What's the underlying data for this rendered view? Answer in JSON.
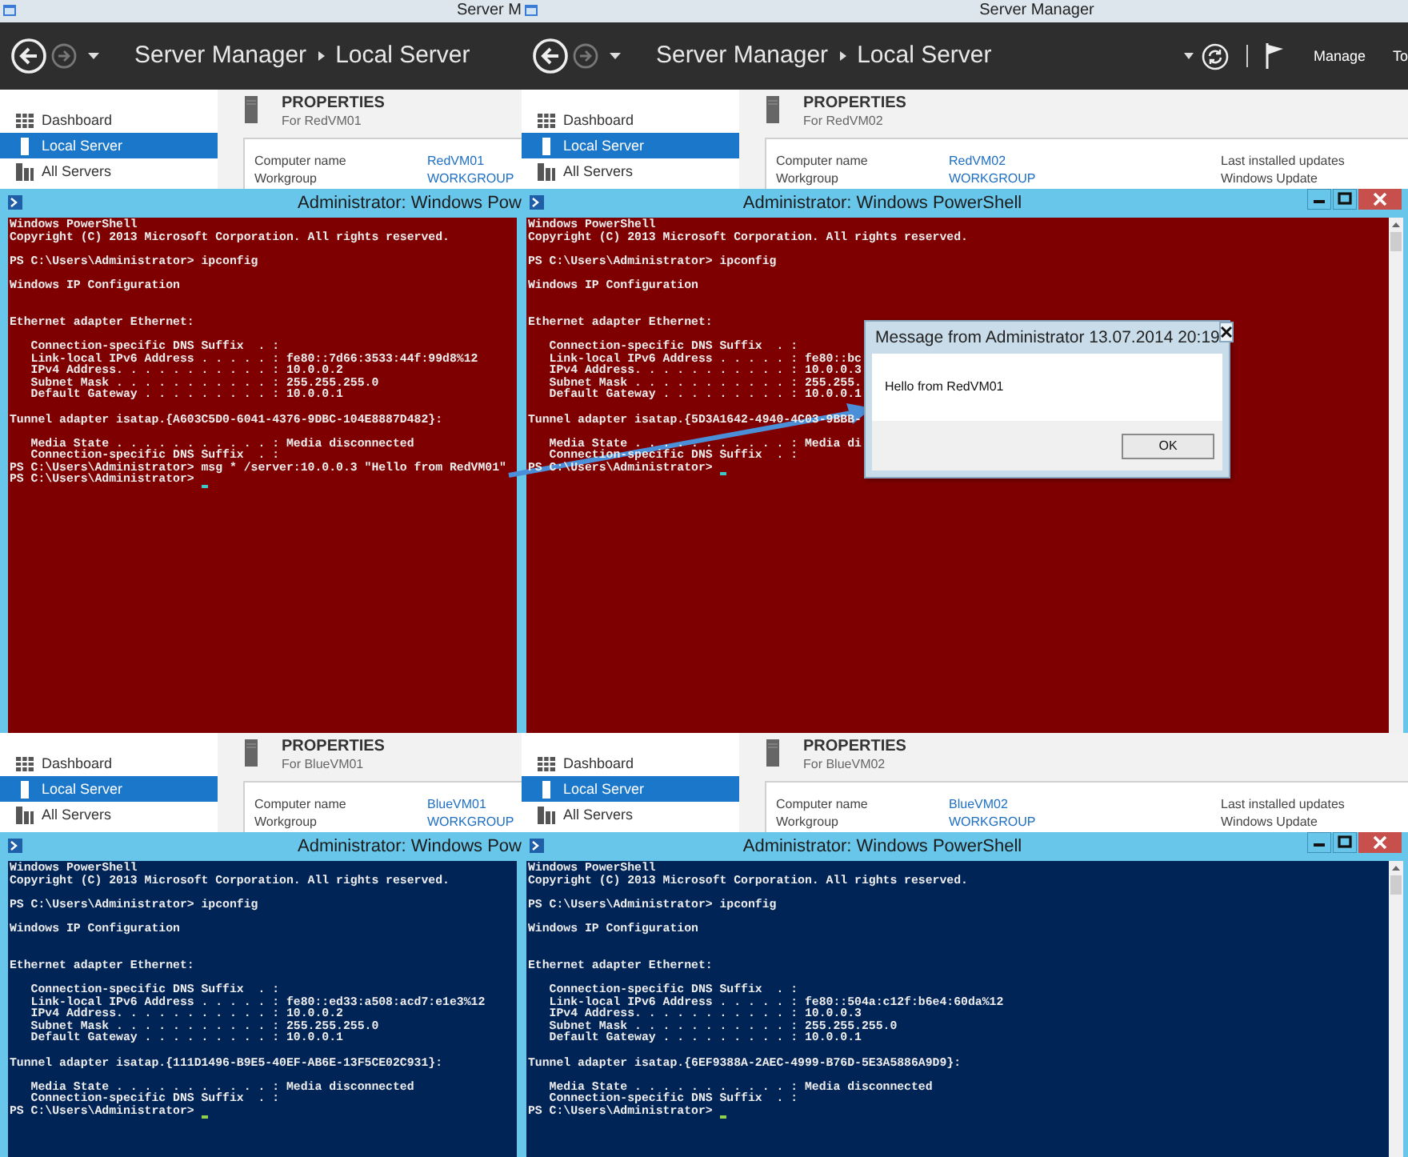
{
  "screens": [
    {
      "title_bar": "Server M",
      "header": {
        "breadcrumb": [
          "Server Manager",
          "Local Server"
        ]
      },
      "sidebar": [
        {
          "label": "Dashboard",
          "selected": false
        },
        {
          "label": "Local Server",
          "selected": true
        },
        {
          "label": "All Servers",
          "selected": false
        }
      ],
      "properties": {
        "heading": "PROPERTIES",
        "subtitle": "For RedVM01",
        "fields": [
          {
            "label": "Computer name",
            "value": "RedVM01"
          },
          {
            "label": "Workgroup",
            "value": "WORKGROUP"
          }
        ]
      },
      "powershell": {
        "title": "Administrator: Windows Pow",
        "color": "#7f0000",
        "window_buttons": false,
        "cursor": true,
        "blocks": [
          {
            "lines": [
              "Windows PowerShell",
              "Copyright (C) 2013 Microsoft Corporation. All rights reserved."
            ]
          },
          {
            "lines": [
              "PS C:\\Users\\Administrator> ipconfig"
            ]
          },
          {
            "lines": [
              "Windows IP Configuration"
            ],
            "extra_blank": true
          },
          {
            "lines": [
              "Ethernet adapter Ethernet:"
            ]
          },
          {
            "lines": [
              "   Connection-specific DNS Suffix  . :",
              "   Link-local IPv6 Address . . . . . : fe80::7d66:3533:44f:99d8%12",
              "   IPv4 Address. . . . . . . . . . . : 10.0.0.2",
              "   Subnet Mask . . . . . . . . . . . : 255.255.255.0",
              "   Default Gateway . . . . . . . . . : 10.0.0.1"
            ]
          },
          {
            "lines": [
              "Tunnel adapter isatap.{A603C5D0-6041-4376-9DBC-104E8887D482}:"
            ]
          },
          {
            "lines": [
              "   Media State . . . . . . . . . . . : Media disconnected",
              "   Connection-specific DNS Suffix  . :",
              "PS C:\\Users\\Administrator> msg * /server:10.0.0.3 \"Hello from RedVM01\"",
              "PS C:\\Users\\Administrator> "
            ]
          }
        ]
      }
    },
    {
      "title_bar": "Server Manager",
      "header": {
        "breadcrumb": [
          "Server Manager",
          "Local Server"
        ],
        "menu": [
          "Manage",
          "To"
        ]
      },
      "sidebar": [
        {
          "label": "Dashboard",
          "selected": false
        },
        {
          "label": "Local Server",
          "selected": true
        },
        {
          "label": "All Servers",
          "selected": false
        }
      ],
      "properties": {
        "heading": "PROPERTIES",
        "subtitle": "For RedVM02",
        "fields": [
          {
            "label": "Computer name",
            "value": "RedVM02"
          },
          {
            "label": "Workgroup",
            "value": "WORKGROUP"
          }
        ],
        "side_labels": [
          "Last installed updates",
          "Windows Update"
        ]
      },
      "powershell": {
        "title": "Administrator: Windows PowerShell",
        "color": "#7f0000",
        "window_buttons": true,
        "cursor": true,
        "blocks": [
          {
            "lines": [
              "Windows PowerShell",
              "Copyright (C) 2013 Microsoft Corporation. All rights reserved."
            ]
          },
          {
            "lines": [
              "PS C:\\Users\\Administrator> ipconfig"
            ]
          },
          {
            "lines": [
              "Windows IP Configuration"
            ],
            "extra_blank": true
          },
          {
            "lines": [
              "Ethernet adapter Ethernet:"
            ]
          },
          {
            "lines": [
              "   Connection-specific DNS Suffix  . :",
              "   Link-local IPv6 Address . . . . . : fe80::bc",
              "   IPv4 Address. . . . . . . . . . . : 10.0.0.3",
              "   Subnet Mask . . . . . . . . . . . : 255.255.",
              "   Default Gateway . . . . . . . . . : 10.0.0.1"
            ]
          },
          {
            "lines": [
              "Tunnel adapter isatap.{5D3A1642-4940-4C03-9BBB-"
            ]
          },
          {
            "lines": [
              "   Media State . . . . . . . . . . . : Media di",
              "   Connection-specific DNS Suffix  . :",
              "PS C:\\Users\\Administrator> "
            ]
          }
        ]
      },
      "dialog": {
        "title": "Message from Administrator 13.07.2014 20:19",
        "message": "Hello from RedVM01",
        "button": "OK"
      }
    },
    {
      "sidebar": [
        {
          "label": "Dashboard",
          "selected": false
        },
        {
          "label": "Local Server",
          "selected": true
        },
        {
          "label": "All Servers",
          "selected": false
        }
      ],
      "properties": {
        "heading": "PROPERTIES",
        "subtitle": "For BlueVM01",
        "fields": [
          {
            "label": "Computer name",
            "value": "BlueVM01"
          },
          {
            "label": "Workgroup",
            "value": "WORKGROUP"
          }
        ]
      },
      "powershell": {
        "title": "Administrator: Windows Pow",
        "color": "#012456",
        "window_buttons": false,
        "cursor": true,
        "blocks": [
          {
            "lines": [
              "Windows PowerShell",
              "Copyright (C) 2013 Microsoft Corporation. All rights reserved."
            ]
          },
          {
            "lines": [
              "PS C:\\Users\\Administrator> ipconfig"
            ]
          },
          {
            "lines": [
              "Windows IP Configuration"
            ],
            "extra_blank": true
          },
          {
            "lines": [
              "Ethernet adapter Ethernet:"
            ]
          },
          {
            "lines": [
              "   Connection-specific DNS Suffix  . :",
              "   Link-local IPv6 Address . . . . . : fe80::ed33:a508:acd7:e1e3%12",
              "   IPv4 Address. . . . . . . . . . . : 10.0.0.2",
              "   Subnet Mask . . . . . . . . . . . : 255.255.255.0",
              "   Default Gateway . . . . . . . . . : 10.0.0.1"
            ]
          },
          {
            "lines": [
              "Tunnel adapter isatap.{111D1496-B9E5-40EF-AB6E-13F5CE02C931}:"
            ]
          },
          {
            "lines": [
              "   Media State . . . . . . . . . . . : Media disconnected",
              "   Connection-specific DNS Suffix  . :",
              "PS C:\\Users\\Administrator> "
            ]
          }
        ]
      }
    },
    {
      "sidebar": [
        {
          "label": "Dashboard",
          "selected": false
        },
        {
          "label": "Local Server",
          "selected": true
        },
        {
          "label": "All Servers",
          "selected": false
        }
      ],
      "properties": {
        "heading": "PROPERTIES",
        "subtitle": "For BlueVM02",
        "fields": [
          {
            "label": "Computer name",
            "value": "BlueVM02"
          },
          {
            "label": "Workgroup",
            "value": "WORKGROUP"
          }
        ],
        "side_labels": [
          "Last installed updates",
          "Windows Update"
        ]
      },
      "powershell": {
        "title": "Administrator: Windows PowerShell",
        "color": "#012456",
        "window_buttons": true,
        "cursor": true,
        "blocks": [
          {
            "lines": [
              "Windows PowerShell",
              "Copyright (C) 2013 Microsoft Corporation. All rights reserved."
            ]
          },
          {
            "lines": [
              "PS C:\\Users\\Administrator> ipconfig"
            ]
          },
          {
            "lines": [
              "Windows IP Configuration"
            ],
            "extra_blank": true
          },
          {
            "lines": [
              "Ethernet adapter Ethernet:"
            ]
          },
          {
            "lines": [
              "   Connection-specific DNS Suffix  . :",
              "   Link-local IPv6 Address . . . . . : fe80::504a:c12f:b6e4:60da%12",
              "   IPv4 Address. . . . . . . . . . . : 10.0.0.3",
              "   Subnet Mask . . . . . . . . . . . : 255.255.255.0",
              "   Default Gateway . . . . . . . . . : 10.0.0.1"
            ]
          },
          {
            "lines": [
              "Tunnel adapter isatap.{6EF9388A-2AEC-4999-B76D-5E3A5886A9D9}:"
            ]
          },
          {
            "lines": [
              "   Media State . . . . . . . . . . . : Media disconnected",
              "   Connection-specific DNS Suffix  . :",
              "PS C:\\Users\\Administrator> "
            ]
          }
        ]
      }
    }
  ]
}
